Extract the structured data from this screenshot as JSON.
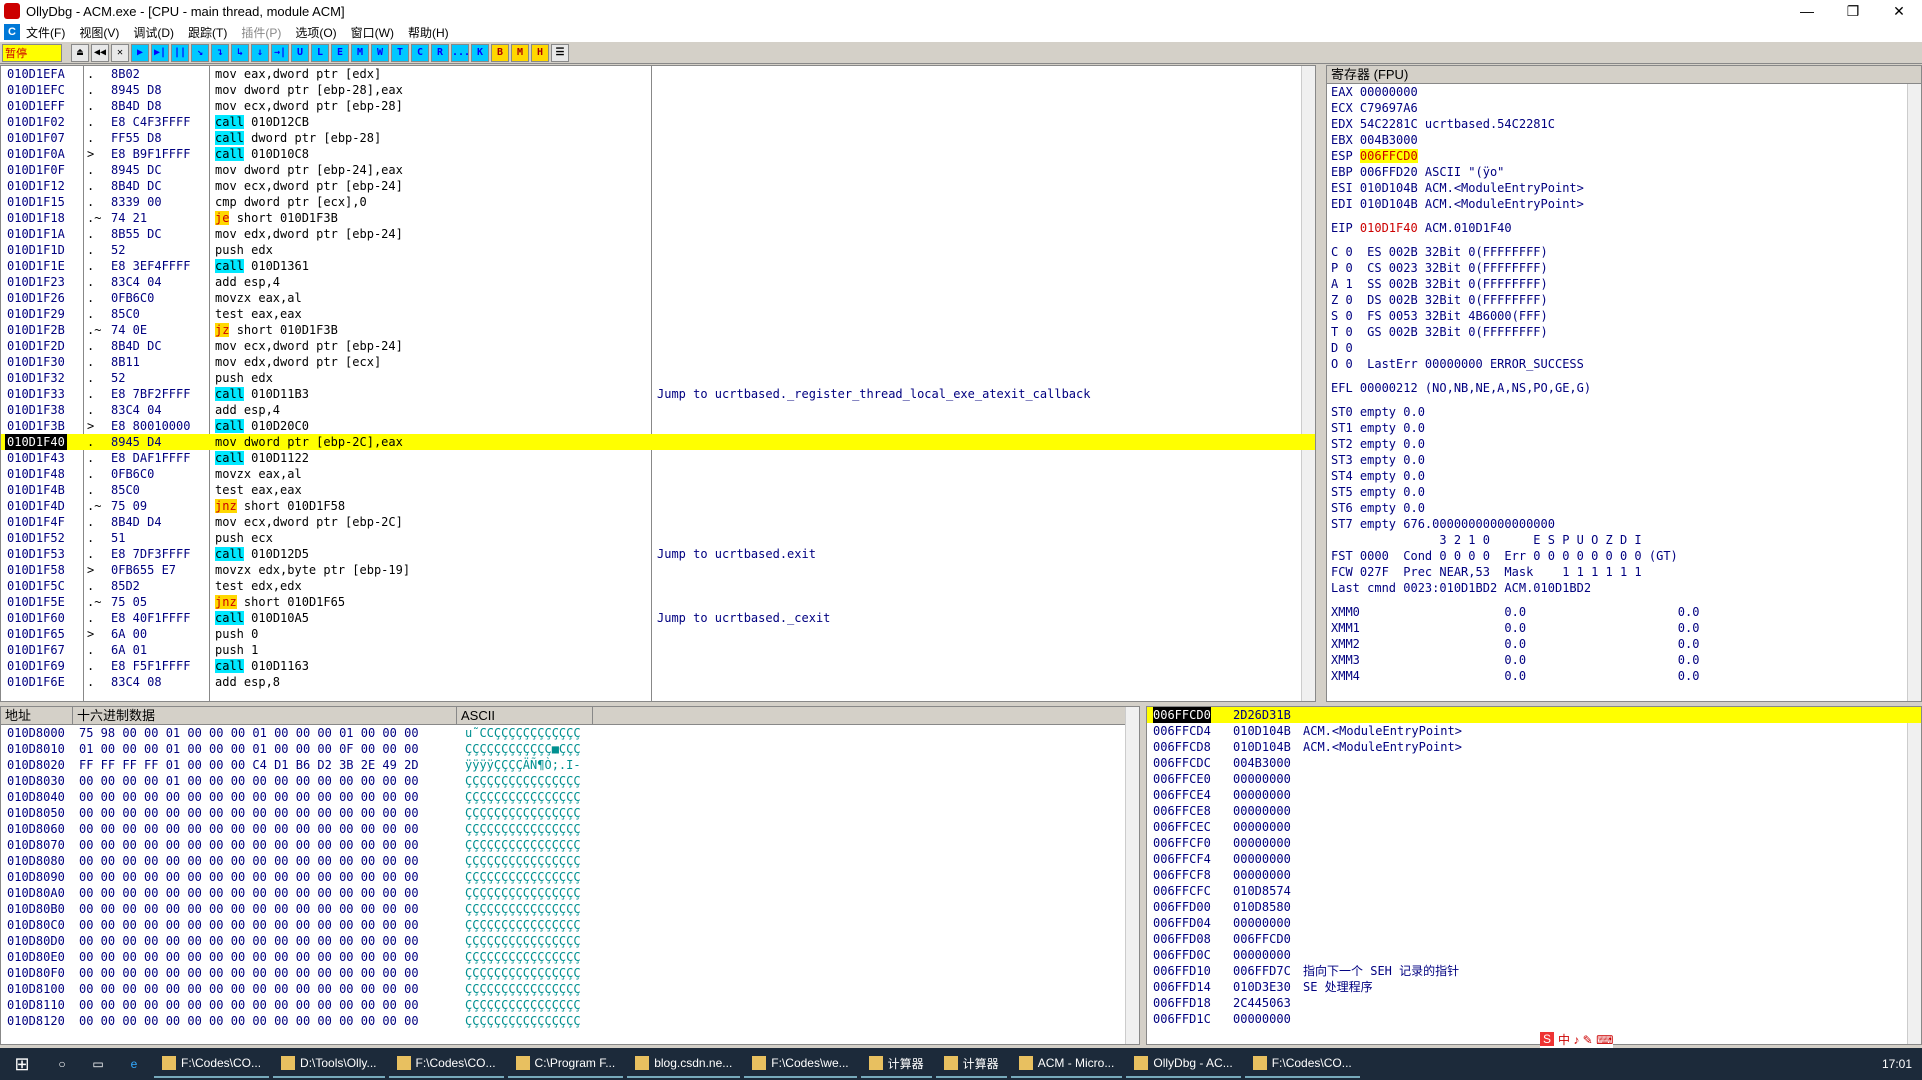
{
  "window": {
    "title": "OllyDbg - ACM.exe - [CPU - main thread, module ACM]",
    "minimize": "—",
    "restore": "❐",
    "close": "✕"
  },
  "menu": [
    "文件(F)",
    "视图(V)",
    "调试(D)",
    "跟踪(T)",
    "插件(P)",
    "选项(O)",
    "窗口(W)",
    "帮助(H)"
  ],
  "toolbar": {
    "status": "暂停",
    "buttons": [
      "⏏",
      "◀◀",
      "✕",
      "▶",
      "▶|",
      "||",
      "↘",
      "↴",
      "↳",
      "↓",
      "→|",
      "U",
      "L",
      "E",
      "M",
      "W",
      "T",
      "C",
      "R",
      "...",
      "K",
      "B",
      "M",
      "H",
      "☰"
    ]
  },
  "disasm": [
    {
      "addr": "010D1EFA",
      "mark": ".",
      "hex": "8B02",
      "asm": "mov eax,dword ptr [edx]",
      "cmt": ""
    },
    {
      "addr": "010D1EFC",
      "mark": ".",
      "hex": "8945 D8",
      "asm": "mov dword ptr [ebp-28],eax",
      "cmt": ""
    },
    {
      "addr": "010D1EFF",
      "mark": ".",
      "hex": "8B4D D8",
      "asm": "mov ecx,dword ptr [ebp-28]",
      "cmt": ""
    },
    {
      "addr": "010D1F02",
      "mark": ".",
      "hex": "E8 C4F3FFFF",
      "op": "call",
      "rest": "010D12CB",
      "cmt": ""
    },
    {
      "addr": "010D1F07",
      "mark": ".",
      "hex": "FF55 D8",
      "op": "call",
      "rest": "dword ptr [ebp-28]",
      "cmt": ""
    },
    {
      "addr": "010D1F0A",
      "mark": ">",
      "hex": "E8 B9F1FFFF",
      "op": "call",
      "rest": "010D10C8",
      "cmt": ""
    },
    {
      "addr": "010D1F0F",
      "mark": ".",
      "hex": "8945 DC",
      "asm": "mov dword ptr [ebp-24],eax",
      "cmt": ""
    },
    {
      "addr": "010D1F12",
      "mark": ".",
      "hex": "8B4D DC",
      "asm": "mov ecx,dword ptr [ebp-24]",
      "cmt": ""
    },
    {
      "addr": "010D1F15",
      "mark": ".",
      "hex": "8339 00",
      "asm": "cmp dword ptr [ecx],0",
      "cmt": ""
    },
    {
      "addr": "010D1F18",
      "mark": ".~",
      "hex": "74 21",
      "jop": "je",
      "rest": "short 010D1F3B",
      "cmt": ""
    },
    {
      "addr": "010D1F1A",
      "mark": ".",
      "hex": "8B55 DC",
      "asm": "mov edx,dword ptr [ebp-24]",
      "cmt": ""
    },
    {
      "addr": "010D1F1D",
      "mark": ".",
      "hex": "52",
      "asm": "push edx",
      "cmt": ""
    },
    {
      "addr": "010D1F1E",
      "mark": ".",
      "hex": "E8 3EF4FFFF",
      "op": "call",
      "rest": "010D1361",
      "cmt": ""
    },
    {
      "addr": "010D1F23",
      "mark": ".",
      "hex": "83C4 04",
      "asm": "add esp,4",
      "cmt": ""
    },
    {
      "addr": "010D1F26",
      "mark": ".",
      "hex": "0FB6C0",
      "asm": "movzx eax,al",
      "cmt": ""
    },
    {
      "addr": "010D1F29",
      "mark": ".",
      "hex": "85C0",
      "asm": "test eax,eax",
      "cmt": ""
    },
    {
      "addr": "010D1F2B",
      "mark": ".~",
      "hex": "74 0E",
      "jop": "jz",
      "rest": "short 010D1F3B",
      "cmt": ""
    },
    {
      "addr": "010D1F2D",
      "mark": ".",
      "hex": "8B4D DC",
      "asm": "mov ecx,dword ptr [ebp-24]",
      "cmt": ""
    },
    {
      "addr": "010D1F30",
      "mark": ".",
      "hex": "8B11",
      "asm": "mov edx,dword ptr [ecx]",
      "cmt": ""
    },
    {
      "addr": "010D1F32",
      "mark": ".",
      "hex": "52",
      "asm": "push edx",
      "cmt": ""
    },
    {
      "addr": "010D1F33",
      "mark": ".",
      "hex": "E8 7BF2FFFF",
      "op": "call",
      "rest": "010D11B3",
      "cmt": "Jump to ucrtbased._register_thread_local_exe_atexit_callback"
    },
    {
      "addr": "010D1F38",
      "mark": ".",
      "hex": "83C4 04",
      "asm": "add esp,4",
      "cmt": ""
    },
    {
      "addr": "010D1F3B",
      "mark": ">",
      "hex": "E8 80010000",
      "op": "call",
      "rest": "010D20C0",
      "cmt": ""
    },
    {
      "addr": "010D1F40",
      "mark": ".",
      "hex": "8945 D4",
      "asm": "mov dword ptr [ebp-2C],eax",
      "cmt": "",
      "sel": true
    },
    {
      "addr": "010D1F43",
      "mark": ".",
      "hex": "E8 DAF1FFFF",
      "op": "call",
      "rest": "010D1122",
      "cmt": ""
    },
    {
      "addr": "010D1F48",
      "mark": ".",
      "hex": "0FB6C0",
      "asm": "movzx eax,al",
      "cmt": ""
    },
    {
      "addr": "010D1F4B",
      "mark": ".",
      "hex": "85C0",
      "asm": "test eax,eax",
      "cmt": ""
    },
    {
      "addr": "010D1F4D",
      "mark": ".~",
      "hex": "75 09",
      "jop": "jnz",
      "rest": "short 010D1F58",
      "cmt": ""
    },
    {
      "addr": "010D1F4F",
      "mark": ".",
      "hex": "8B4D D4",
      "asm": "mov ecx,dword ptr [ebp-2C]",
      "cmt": ""
    },
    {
      "addr": "010D1F52",
      "mark": ".",
      "hex": "51",
      "asm": "push ecx",
      "cmt": ""
    },
    {
      "addr": "010D1F53",
      "mark": ".",
      "hex": "E8 7DF3FFFF",
      "op": "call",
      "rest": "010D12D5",
      "cmt": "Jump to ucrtbased.exit"
    },
    {
      "addr": "010D1F58",
      "mark": ">",
      "hex": "0FB655 E7",
      "asm": "movzx edx,byte ptr [ebp-19]",
      "cmt": ""
    },
    {
      "addr": "010D1F5C",
      "mark": ".",
      "hex": "85D2",
      "asm": "test edx,edx",
      "cmt": ""
    },
    {
      "addr": "010D1F5E",
      "mark": ".~",
      "hex": "75 05",
      "jop": "jnz",
      "rest": "short 010D1F65",
      "cmt": ""
    },
    {
      "addr": "010D1F60",
      "mark": ".",
      "hex": "E8 40F1FFFF",
      "op": "call",
      "rest": "010D10A5",
      "cmt": "Jump to ucrtbased._cexit"
    },
    {
      "addr": "010D1F65",
      "mark": ">",
      "hex": "6A 00",
      "asm": "push 0",
      "cmt": ""
    },
    {
      "addr": "010D1F67",
      "mark": ".",
      "hex": "6A 01",
      "asm": "push 1",
      "cmt": ""
    },
    {
      "addr": "010D1F69",
      "mark": ".",
      "hex": "E8 F5F1FFFF",
      "op": "call",
      "rest": "010D1163",
      "cmt": ""
    },
    {
      "addr": "010D1F6E",
      "mark": ".",
      "hex": "83C4 08",
      "asm": "add esp,8",
      "cmt": ""
    }
  ],
  "registers": {
    "title": "寄存器 (FPU)",
    "lines": [
      "EAX 00000000",
      "ECX C79697A6",
      "EDX 54C2281C ucrtbased.54C2281C",
      "EBX 004B3000",
      "ESP|006FFCD0",
      "EBP 006FFD20 ASCII \"(ÿo\"",
      "ESI 010D104B ACM.<ModuleEntryPoint>",
      "EDI 010D104B ACM.<ModuleEntryPoint>",
      "",
      "EIP|010D1F40| ACM.010D1F40",
      "",
      "C 0  ES 002B 32Bit 0(FFFFFFFF)",
      "P 0  CS 0023 32Bit 0(FFFFFFFF)",
      "A 1  SS 002B 32Bit 0(FFFFFFFF)",
      "Z 0  DS 002B 32Bit 0(FFFFFFFF)",
      "S 0  FS 0053 32Bit 4B6000(FFF)",
      "T 0  GS 002B 32Bit 0(FFFFFFFF)",
      "D 0",
      "O 0  LastErr 00000000 ERROR_SUCCESS",
      "",
      "EFL 00000212 (NO,NB,NE,A,NS,PO,GE,G)",
      "",
      "ST0 empty 0.0",
      "ST1 empty 0.0",
      "ST2 empty 0.0",
      "ST3 empty 0.0",
      "ST4 empty 0.0",
      "ST5 empty 0.0",
      "ST6 empty 0.0",
      "ST7 empty 676.00000000000000000",
      "               3 2 1 0      E S P U O Z D I",
      "FST 0000  Cond 0 0 0 0  Err 0 0 0 0 0 0 0 0 (GT)",
      "FCW 027F  Prec NEAR,53  Mask    1 1 1 1 1 1",
      "Last cmnd 0023:010D1BD2 ACM.010D1BD2",
      "",
      "XMM0                    0.0                     0.0",
      "XMM1                    0.0                     0.0",
      "XMM2                    0.0                     0.0",
      "XMM3                    0.0                     0.0",
      "XMM4                    0.0                     0.0"
    ]
  },
  "dump": {
    "headers": [
      "地址",
      "十六进制数据",
      "ASCII"
    ],
    "rows": [
      {
        "a": "010D8000",
        "h": "75 98 00 00 01 00 00 00 01 00 00 00 01 00 00 00",
        "s": "u˜CCÇÇÇÇÇÇÇÇÇÇÇÇ"
      },
      {
        "a": "010D8010",
        "h": "01 00 00 00 01 00 00 00 01 00 00 00 0F 00 00 00",
        "s": "ÇÇÇÇÇÇÇÇÇÇÇÇ■ÇÇÇ"
      },
      {
        "a": "010D8020",
        "h": "FF FF FF FF 01 00 00 00 C4 D1 B6 D2 3B 2E 49 2D",
        "s": "ÿÿÿÿÇÇÇÇÄÑ¶Ò;.I-"
      },
      {
        "a": "010D8030",
        "h": "00 00 00 00 01 00 00 00 00 00 00 00 00 00 00 00",
        "s": "ÇÇÇÇÇÇÇÇÇÇÇÇÇÇÇÇ"
      },
      {
        "a": "010D8040",
        "h": "00 00 00 00 00 00 00 00 00 00 00 00 00 00 00 00",
        "s": "ÇÇÇÇÇÇÇÇÇÇÇÇÇÇÇÇ"
      },
      {
        "a": "010D8050",
        "h": "00 00 00 00 00 00 00 00 00 00 00 00 00 00 00 00",
        "s": "ÇÇÇÇÇÇÇÇÇÇÇÇÇÇÇÇ"
      },
      {
        "a": "010D8060",
        "h": "00 00 00 00 00 00 00 00 00 00 00 00 00 00 00 00",
        "s": "ÇÇÇÇÇÇÇÇÇÇÇÇÇÇÇÇ"
      },
      {
        "a": "010D8070",
        "h": "00 00 00 00 00 00 00 00 00 00 00 00 00 00 00 00",
        "s": "ÇÇÇÇÇÇÇÇÇÇÇÇÇÇÇÇ"
      },
      {
        "a": "010D8080",
        "h": "00 00 00 00 00 00 00 00 00 00 00 00 00 00 00 00",
        "s": "ÇÇÇÇÇÇÇÇÇÇÇÇÇÇÇÇ"
      },
      {
        "a": "010D8090",
        "h": "00 00 00 00 00 00 00 00 00 00 00 00 00 00 00 00",
        "s": "ÇÇÇÇÇÇÇÇÇÇÇÇÇÇÇÇ"
      },
      {
        "a": "010D80A0",
        "h": "00 00 00 00 00 00 00 00 00 00 00 00 00 00 00 00",
        "s": "ÇÇÇÇÇÇÇÇÇÇÇÇÇÇÇÇ"
      },
      {
        "a": "010D80B0",
        "h": "00 00 00 00 00 00 00 00 00 00 00 00 00 00 00 00",
        "s": "ÇÇÇÇÇÇÇÇÇÇÇÇÇÇÇÇ"
      },
      {
        "a": "010D80C0",
        "h": "00 00 00 00 00 00 00 00 00 00 00 00 00 00 00 00",
        "s": "ÇÇÇÇÇÇÇÇÇÇÇÇÇÇÇÇ"
      },
      {
        "a": "010D80D0",
        "h": "00 00 00 00 00 00 00 00 00 00 00 00 00 00 00 00",
        "s": "ÇÇÇÇÇÇÇÇÇÇÇÇÇÇÇÇ"
      },
      {
        "a": "010D80E0",
        "h": "00 00 00 00 00 00 00 00 00 00 00 00 00 00 00 00",
        "s": "ÇÇÇÇÇÇÇÇÇÇÇÇÇÇÇÇ"
      },
      {
        "a": "010D80F0",
        "h": "00 00 00 00 00 00 00 00 00 00 00 00 00 00 00 00",
        "s": "ÇÇÇÇÇÇÇÇÇÇÇÇÇÇÇÇ"
      },
      {
        "a": "010D8100",
        "h": "00 00 00 00 00 00 00 00 00 00 00 00 00 00 00 00",
        "s": "ÇÇÇÇÇÇÇÇÇÇÇÇÇÇÇÇ"
      },
      {
        "a": "010D8110",
        "h": "00 00 00 00 00 00 00 00 00 00 00 00 00 00 00 00",
        "s": "ÇÇÇÇÇÇÇÇÇÇÇÇÇÇÇÇ"
      },
      {
        "a": "010D8120",
        "h": "00 00 00 00 00 00 00 00 00 00 00 00 00 00 00 00",
        "s": "ÇÇÇÇÇÇÇÇÇÇÇÇÇÇÇÇ"
      }
    ]
  },
  "stack": [
    {
      "a": "006FFCD0",
      "v": "2D26D31B",
      "c": "",
      "top": true
    },
    {
      "a": "006FFCD4",
      "v": "010D104B",
      "c": "ACM.<ModuleEntryPoint>"
    },
    {
      "a": "006FFCD8",
      "v": "010D104B",
      "c": "ACM.<ModuleEntryPoint>"
    },
    {
      "a": "006FFCDC",
      "v": "004B3000",
      "c": ""
    },
    {
      "a": "006FFCE0",
      "v": "00000000",
      "c": ""
    },
    {
      "a": "006FFCE4",
      "v": "00000000",
      "c": ""
    },
    {
      "a": "006FFCE8",
      "v": "00000000",
      "c": ""
    },
    {
      "a": "006FFCEC",
      "v": "00000000",
      "c": ""
    },
    {
      "a": "006FFCF0",
      "v": "00000000",
      "c": ""
    },
    {
      "a": "006FFCF4",
      "v": "00000000",
      "c": ""
    },
    {
      "a": "006FFCF8",
      "v": "00000000",
      "c": ""
    },
    {
      "a": "006FFCFC",
      "v": "010D8574",
      "c": ""
    },
    {
      "a": "006FFD00",
      "v": "010D8580",
      "c": ""
    },
    {
      "a": "006FFD04",
      "v": "00000000",
      "c": ""
    },
    {
      "a": "006FFD08",
      "v": "006FFCD0",
      "c": ""
    },
    {
      "a": "006FFD0C",
      "v": "00000000",
      "c": ""
    },
    {
      "a": "006FFD10",
      "v": "006FFD7C",
      "c": "指向下一个 SEH 记录的指针"
    },
    {
      "a": "006FFD14",
      "v": "010D3E30",
      "c": "SE 处理程序"
    },
    {
      "a": "006FFD18",
      "v": "2C445063",
      "c": ""
    },
    {
      "a": "006FFD1C",
      "v": "00000000",
      "c": ""
    }
  ],
  "taskbar": {
    "items": [
      "F:\\Codes\\CO...",
      "D:\\Tools\\Olly...",
      "F:\\Codes\\CO...",
      "C:\\Program F...",
      "blog.csdn.ne...",
      "F:\\Codes\\we...",
      "计算器",
      "计算器",
      "ACM - Micro...",
      "OllyDbg - AC...",
      "F:\\Codes\\CO..."
    ],
    "time": "17:01"
  },
  "ime": "中 ♪ ✎ ⌨"
}
